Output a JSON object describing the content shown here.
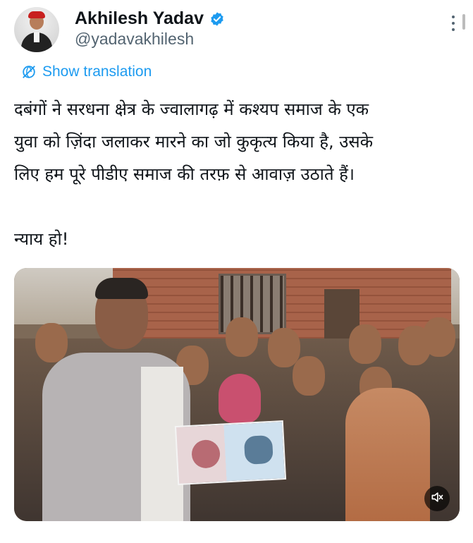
{
  "author": {
    "display_name": "Akhilesh Yadav",
    "handle": "@yadavakhilesh",
    "verified": true,
    "avatar_icon": "profile-avatar"
  },
  "actions": {
    "more_icon": "vertical-ellipsis-icon",
    "translate_label": "Show translation",
    "translate_icon": "globe-slash-icon"
  },
  "tweet": {
    "lines": [
      "दबंगों ने सरधना क्षेत्र के ज्वालागढ़ में कश्यप समाज के एक",
      "युवा को ज़िंदा जलाकर मारने का जो कुकृत्य किया है, उसके",
      "लिए हम पूरे पीडीए समाज की तरफ़ से आवाज़ उठाते हैं।",
      "न्याय हो!"
    ]
  },
  "media": {
    "type": "video",
    "mute_icon": "speaker-muted-icon"
  },
  "colors": {
    "link": "#1d9bf0",
    "secondary_text": "#536471",
    "primary_text": "#0f1419"
  }
}
